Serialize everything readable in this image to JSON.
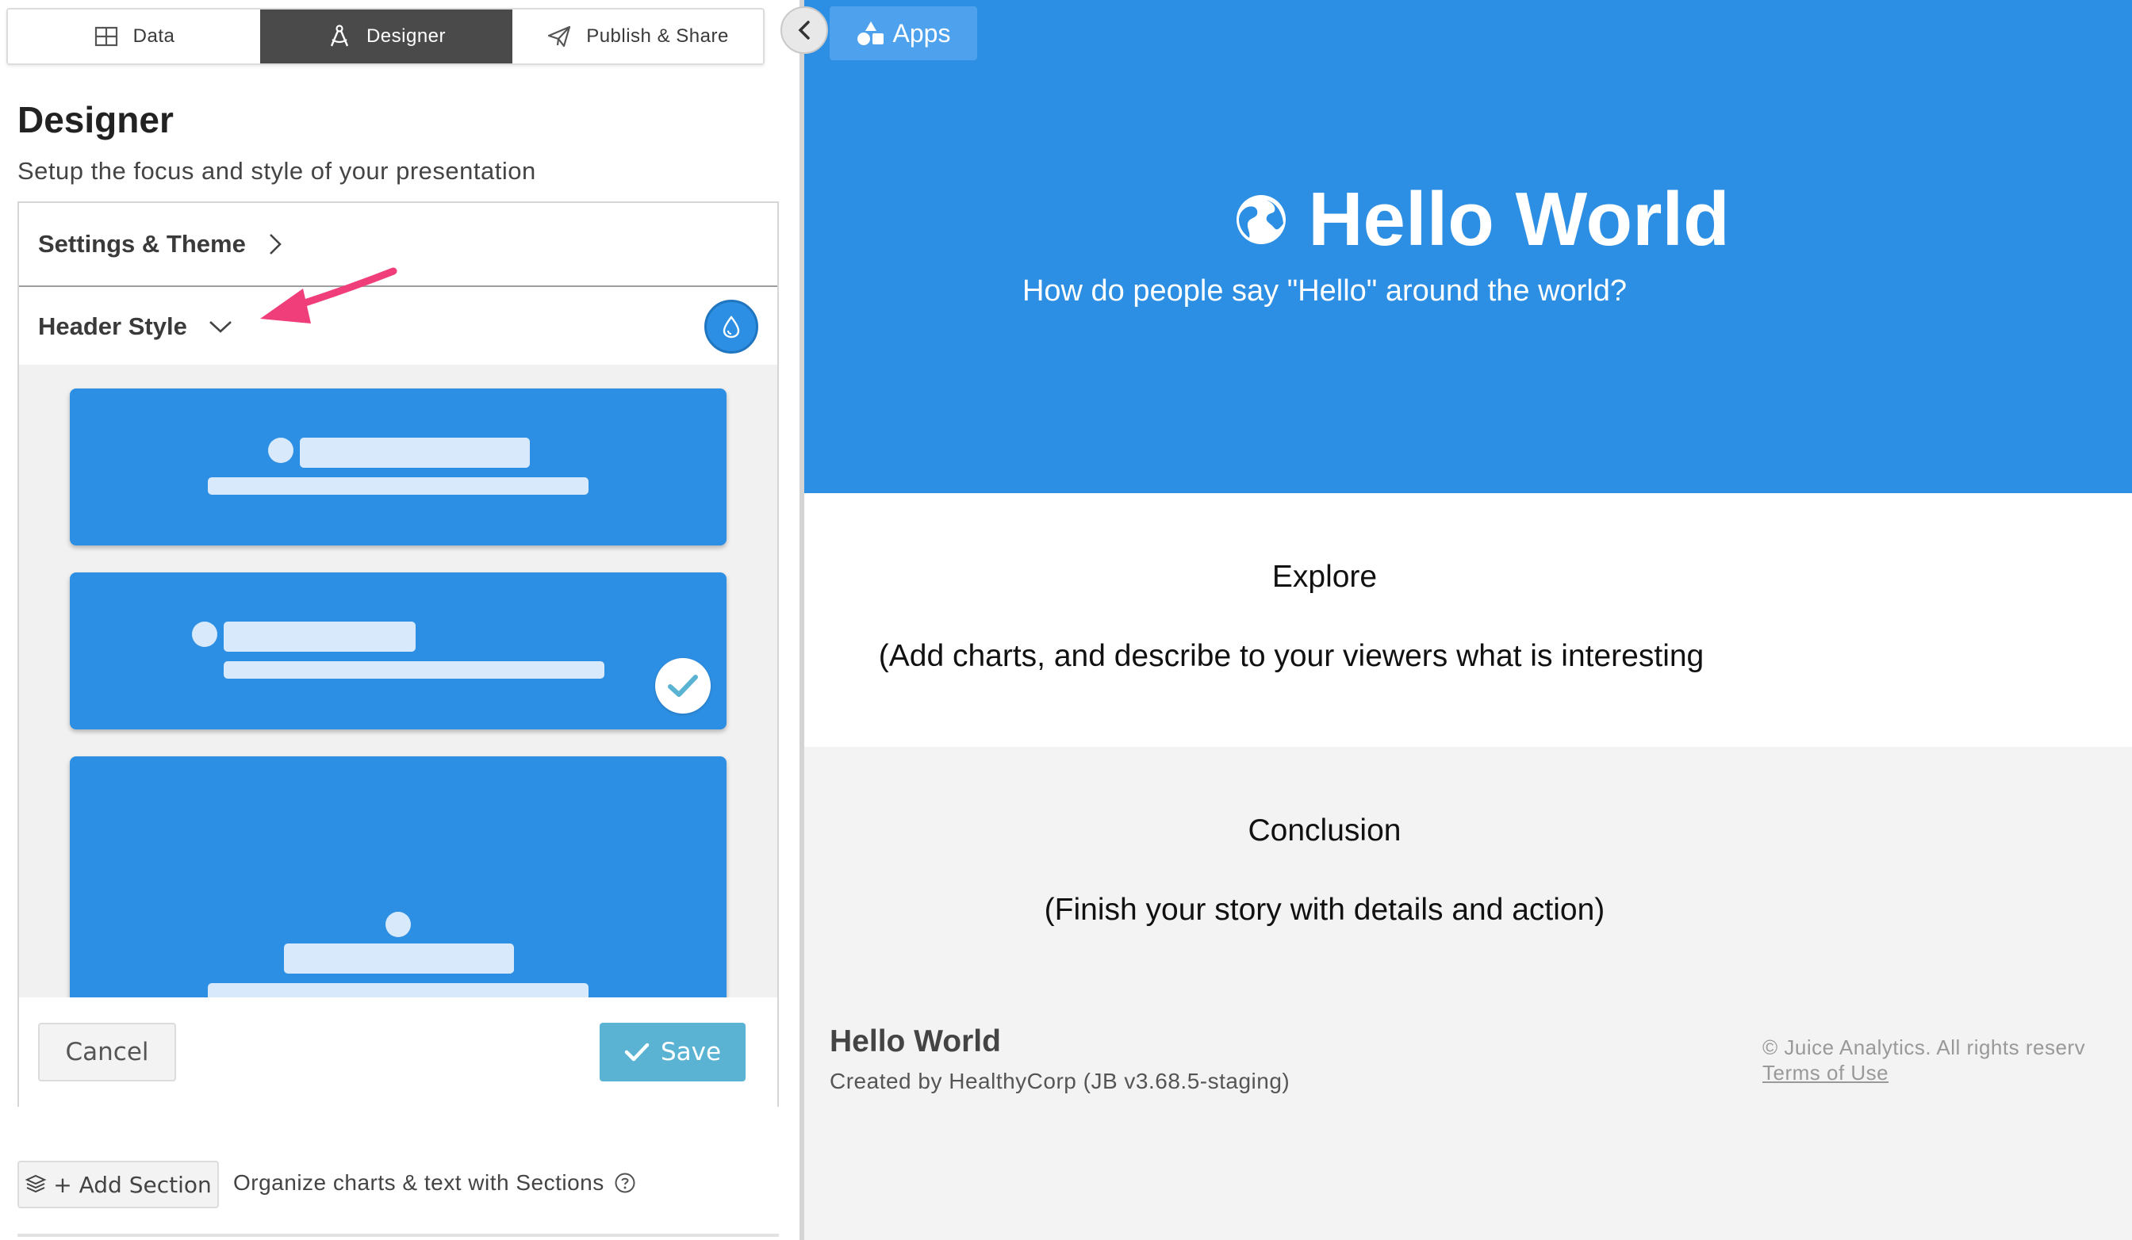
{
  "tabs": [
    {
      "label": "Data",
      "icon": "table-icon"
    },
    {
      "label": "Designer",
      "icon": "compass-icon",
      "active": true
    },
    {
      "label": "Publish & Share",
      "icon": "paper-plane-icon"
    }
  ],
  "panel": {
    "title": "Designer",
    "subtitle": "Setup the focus and style of your presentation",
    "settings_label": "Settings & Theme",
    "header_style_label": "Header Style",
    "selected_style_index": 1,
    "cancel_label": "Cancel",
    "save_label": "Save",
    "add_section_label": "+ Add Section",
    "organize_text": "Organize charts & text with Sections"
  },
  "preview": {
    "apps_label": "Apps",
    "hero_title": "Hello World",
    "hero_subtitle": "How do people say \"Hello\" around the world?",
    "explore_heading": "Explore",
    "explore_text": "(Add charts, and describe to your viewers what is interesting",
    "conclusion_heading": "Conclusion",
    "conclusion_text": "(Finish your story with details and action)",
    "footer_title": "Hello World",
    "footer_created": "Created by HealthyCorp (JB v3.68.5-staging)",
    "footer_copyright": "© Juice Analytics. All rights reserv",
    "footer_terms": "Terms of Use"
  },
  "colors": {
    "header_blue": "#2d8fe3",
    "active_tab": "#4a4a4a",
    "save_button": "#5bb3d4",
    "annotation_arrow": "#f03e7a"
  }
}
